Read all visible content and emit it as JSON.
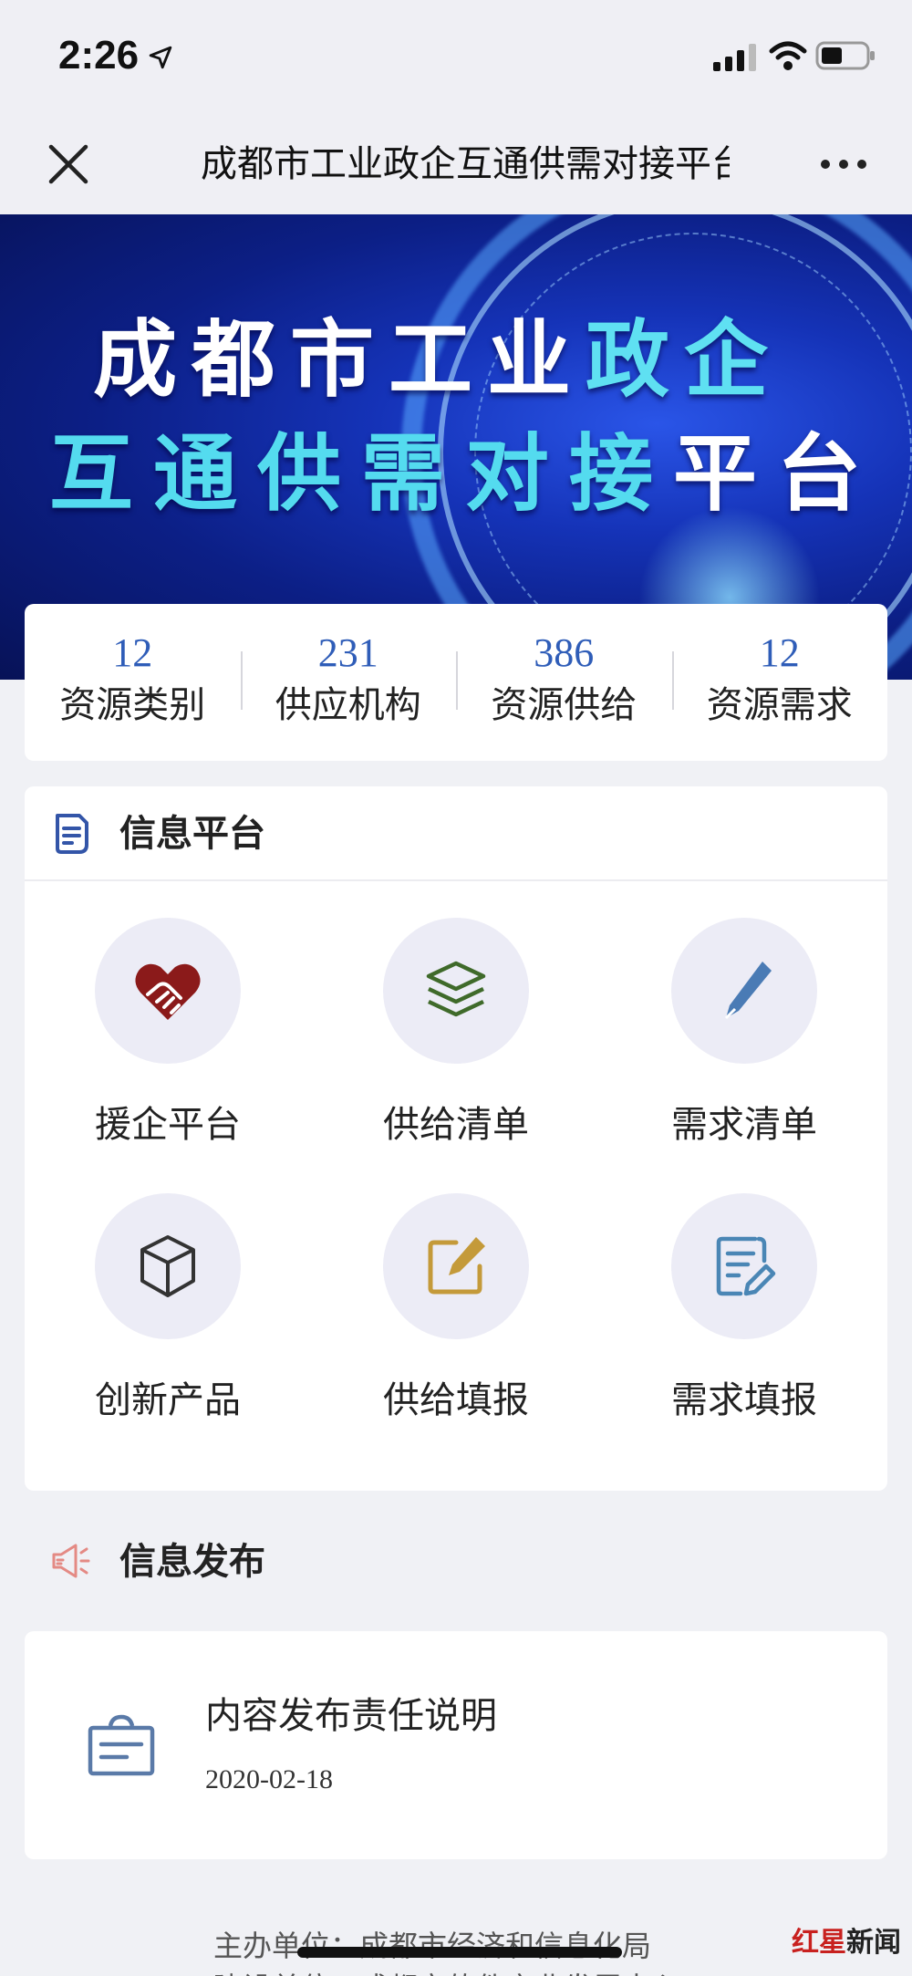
{
  "status_bar": {
    "time": "2:26"
  },
  "nav": {
    "title": "成都市工业政企互通供需对接平台"
  },
  "banner": {
    "line1_white": "成都市工业",
    "line1_cyan": "政企",
    "line2_cyan": "互通供需对接",
    "line2_white": "平台"
  },
  "stats": [
    {
      "value": "12",
      "label": "资源类别"
    },
    {
      "value": "231",
      "label": "供应机构"
    },
    {
      "value": "386",
      "label": "资源供给"
    },
    {
      "value": "12",
      "label": "资源需求"
    }
  ],
  "platform": {
    "title": "信息平台",
    "items": [
      {
        "label": "援企平台",
        "icon": "handshake-heart-icon"
      },
      {
        "label": "供给清单",
        "icon": "layers-icon"
      },
      {
        "label": "需求清单",
        "icon": "pen-nib-icon"
      },
      {
        "label": "创新产品",
        "icon": "cube-icon"
      },
      {
        "label": "供给填报",
        "icon": "edit-square-icon"
      },
      {
        "label": "需求填报",
        "icon": "form-edit-icon"
      }
    ]
  },
  "publish": {
    "title": "信息发布",
    "notice": {
      "title": "内容发布责任说明",
      "date": "2020-02-18"
    }
  },
  "footer": {
    "line1": "主办单位：成都市经济和信息化局",
    "line2": "建设单位：成都市软件产业发展中心"
  },
  "watermark": {
    "red": "红星",
    "black": "新闻"
  },
  "colors": {
    "stat_number": "#2f5db8",
    "banner_cyan": "#54dbef",
    "banner_bg": "#0c1f86"
  }
}
